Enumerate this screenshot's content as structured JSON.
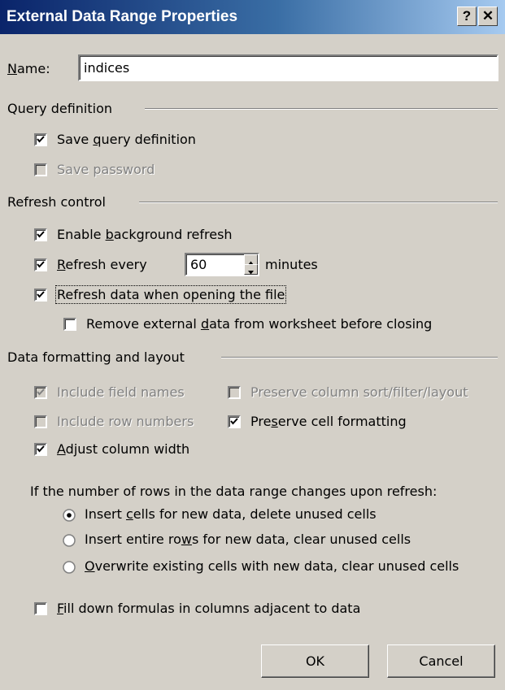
{
  "window": {
    "title": "External Data Range Properties",
    "help_label": "?",
    "close_label": "✕"
  },
  "name_field": {
    "label_accel": "N",
    "label_rest": "ame:",
    "value": "indices"
  },
  "query_definition": {
    "heading": "Query definition",
    "save_query": {
      "pre": "Save ",
      "accel": "q",
      "post": "uery definition",
      "checked": true
    },
    "save_password": {
      "label": "Save password",
      "checked": false,
      "disabled": true
    }
  },
  "refresh_control": {
    "heading": "Refresh control",
    "background": {
      "pre": "Enable ",
      "accel": "b",
      "post": "ackground refresh",
      "checked": true
    },
    "refresh_every": {
      "pre": "",
      "accel": "R",
      "post": "efresh every",
      "checked": true,
      "value": "60",
      "unit": "minutes"
    },
    "on_open": {
      "pre": "Refresh data when opening the f",
      "accel": "i",
      "post": "le",
      "checked": true
    },
    "remove_external": {
      "pre": "Remove external ",
      "accel": "d",
      "post": "ata from worksheet before closing",
      "checked": false
    }
  },
  "formatting": {
    "heading": "Data formatting and layout",
    "include_field_names": {
      "label": "Include field names",
      "checked": true,
      "disabled": true
    },
    "preserve_sort": {
      "label": "Preserve column sort/filter/layout",
      "checked": false,
      "disabled": true
    },
    "include_row_numbers": {
      "label": "Include row numbers",
      "checked": false,
      "disabled": true
    },
    "preserve_cell": {
      "pre": "Pre",
      "accel": "s",
      "post": "erve cell formatting",
      "checked": true
    },
    "adjust_width": {
      "pre": "",
      "accel": "A",
      "post": "djust column width",
      "checked": true
    },
    "rows_change_prompt": "If the number of rows in the data range changes upon refresh:",
    "options": [
      {
        "pre": "Insert ",
        "accel": "c",
        "post": "ells for new data, delete unused cells",
        "selected": true
      },
      {
        "pre": "Insert entire ro",
        "accel": "w",
        "post": "s for new data, clear unused cells",
        "selected": false
      },
      {
        "pre": "",
        "accel": "O",
        "post": "verwrite existing cells with new data, clear unused cells",
        "selected": false
      }
    ],
    "fill_down": {
      "pre": "",
      "accel": "F",
      "post": "ill down formulas in columns adjacent to data",
      "checked": false
    }
  },
  "buttons": {
    "ok": "OK",
    "cancel": "Cancel"
  }
}
